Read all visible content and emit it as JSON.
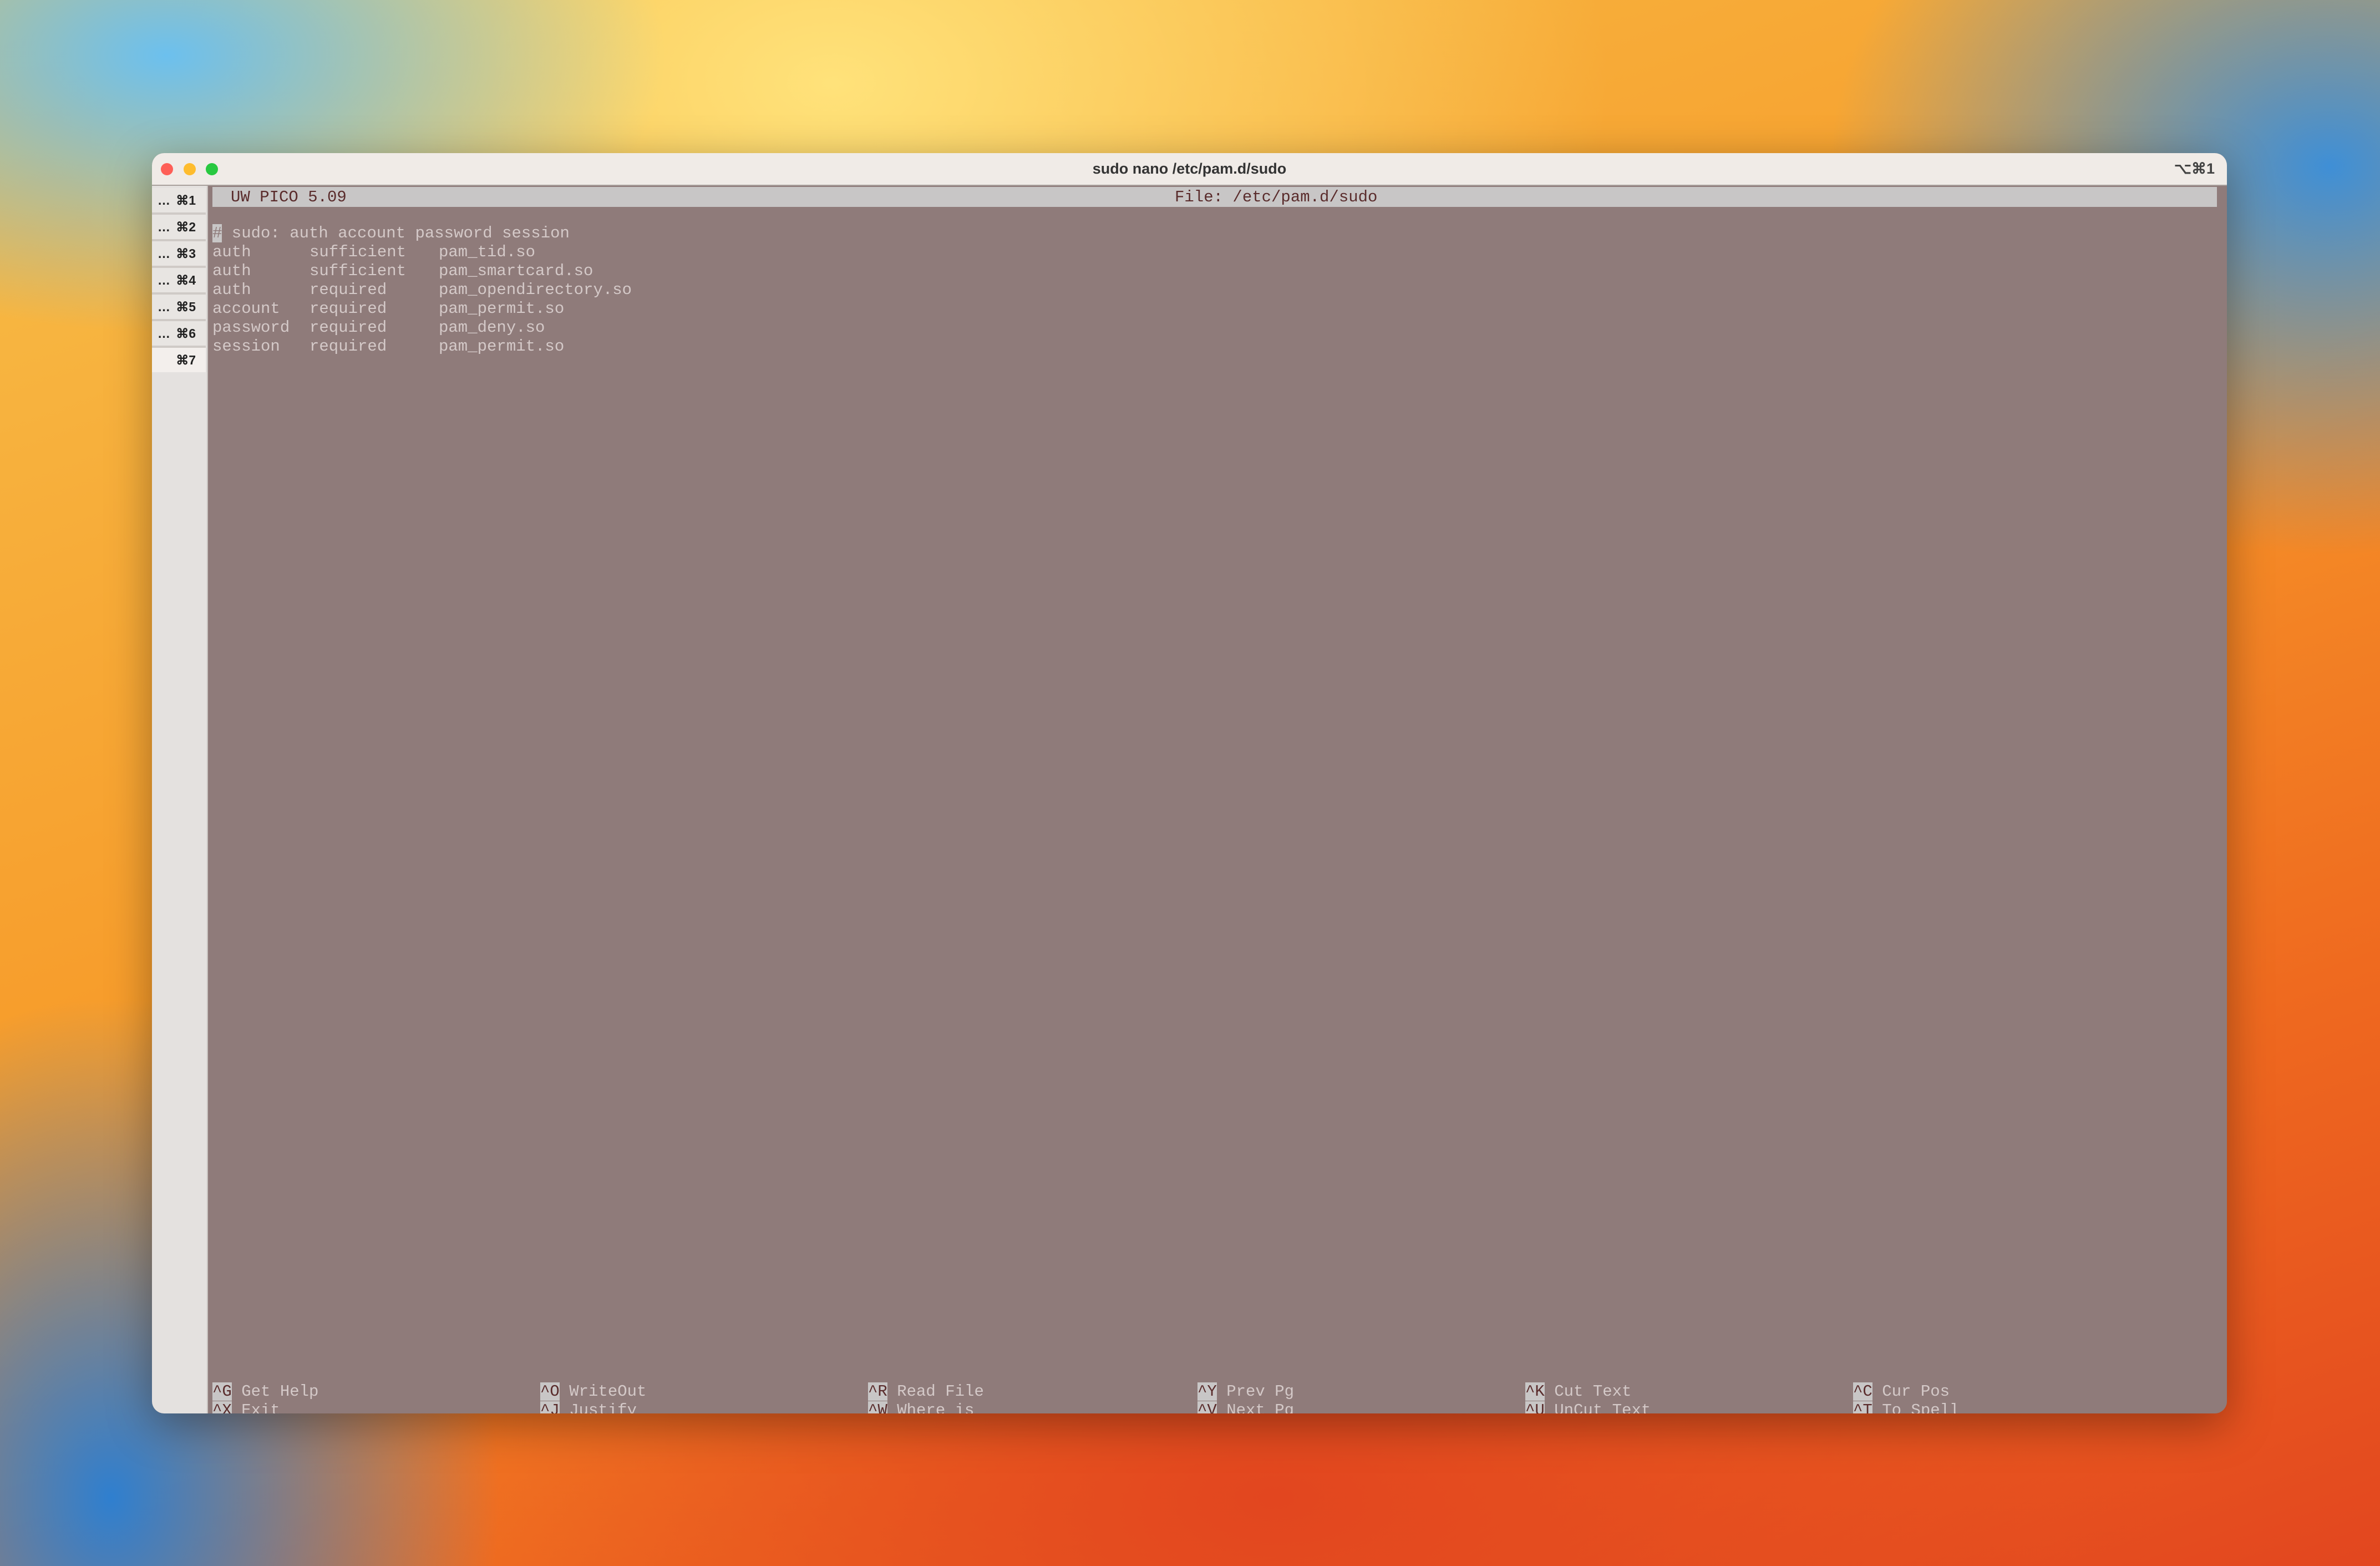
{
  "window": {
    "title": "sudo nano /etc/pam.d/sudo",
    "shortcut": "⌥⌘1"
  },
  "tabs": [
    {
      "dots": "…",
      "key": "⌘1"
    },
    {
      "dots": "…",
      "key": "⌘2"
    },
    {
      "dots": "…",
      "key": "⌘3"
    },
    {
      "dots": "…",
      "key": "⌘4"
    },
    {
      "dots": "…",
      "key": "⌘5"
    },
    {
      "dots": "…",
      "key": "⌘6"
    },
    {
      "dots": "",
      "key": "⌘7"
    }
  ],
  "editor": {
    "app": "UW PICO 5.09",
    "file": "File: /etc/pam.d/sudo",
    "comment_char": "#",
    "comment_rest": " sudo: auth account password session",
    "rows": [
      [
        "auth",
        "sufficient",
        "pam_tid.so"
      ],
      [
        "auth",
        "sufficient",
        "pam_smartcard.so"
      ],
      [
        "auth",
        "required",
        "pam_opendirectory.so"
      ],
      [
        "account",
        "required",
        "pam_permit.so"
      ],
      [
        "password",
        "required",
        "pam_deny.so"
      ],
      [
        "session",
        "required",
        "pam_permit.so"
      ]
    ]
  },
  "shortcuts": [
    [
      {
        "key": "^G",
        "label": "Get Help"
      },
      {
        "key": "^X",
        "label": "Exit"
      }
    ],
    [
      {
        "key": "^O",
        "label": "WriteOut"
      },
      {
        "key": "^J",
        "label": "Justify"
      }
    ],
    [
      {
        "key": "^R",
        "label": "Read File"
      },
      {
        "key": "^W",
        "label": "Where is"
      }
    ],
    [
      {
        "key": "^Y",
        "label": "Prev Pg"
      },
      {
        "key": "^V",
        "label": "Next Pg"
      }
    ],
    [
      {
        "key": "^K",
        "label": "Cut Text"
      },
      {
        "key": "^U",
        "label": "UnCut Text"
      }
    ],
    [
      {
        "key": "^C",
        "label": "Cur Pos"
      },
      {
        "key": "^T",
        "label": "To Spell"
      }
    ]
  ]
}
